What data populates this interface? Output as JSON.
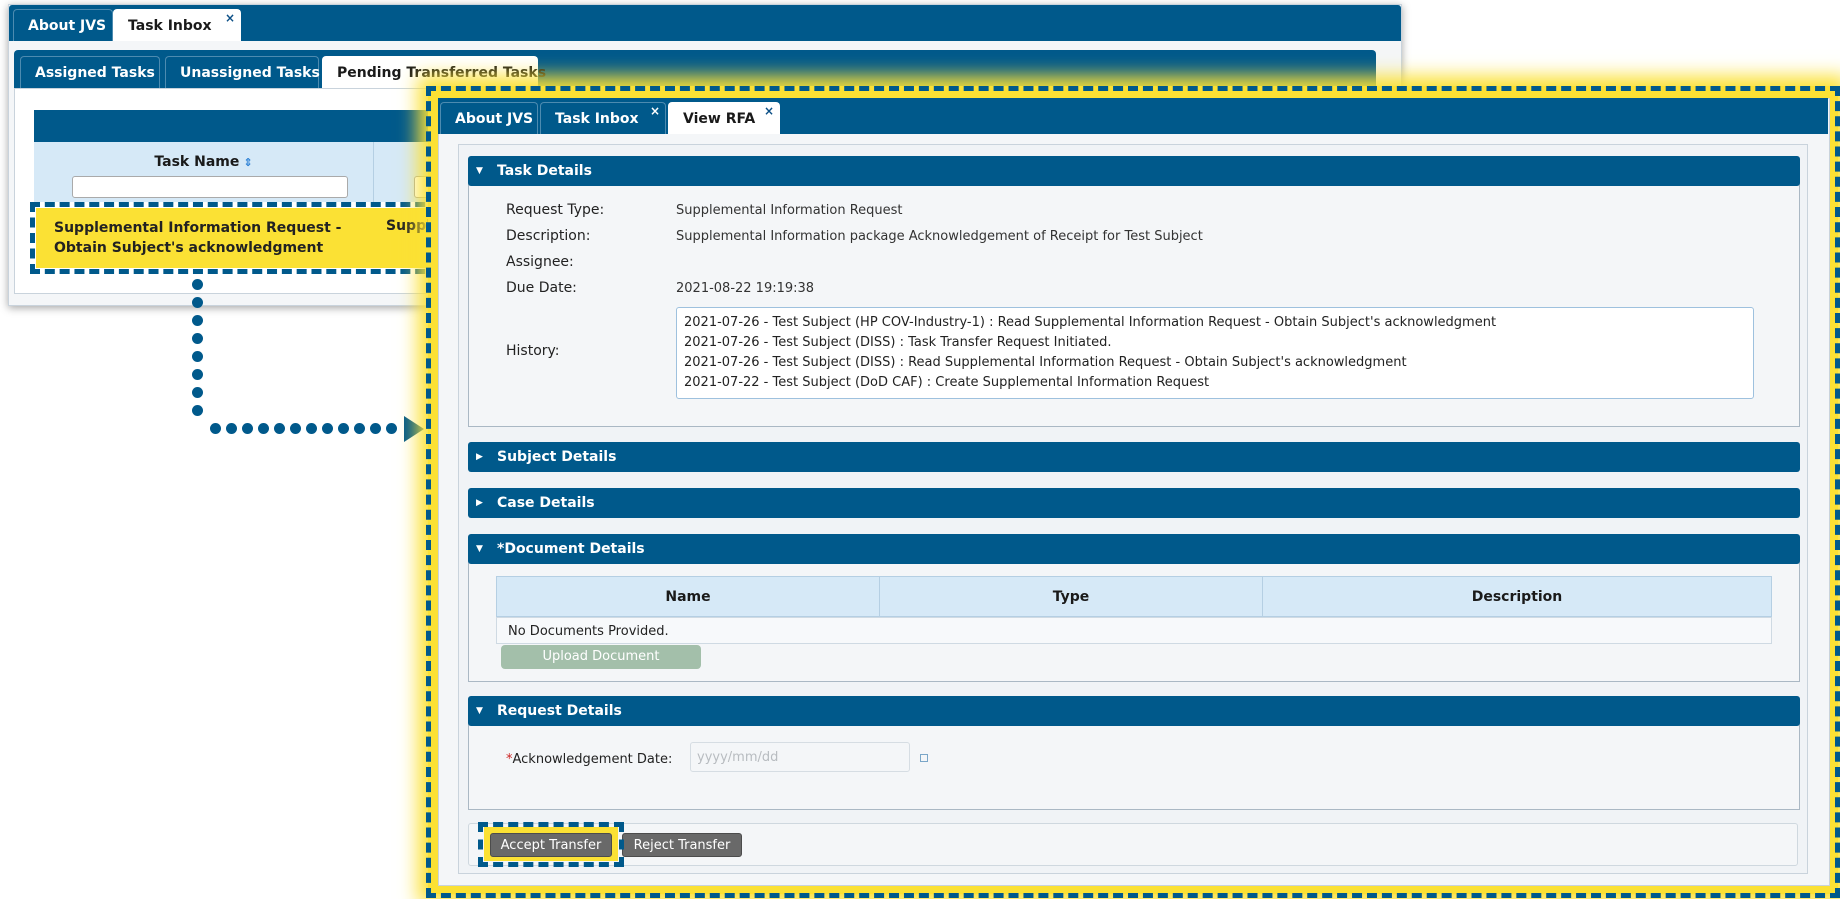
{
  "background_window": {
    "tabs": [
      {
        "label": "About JVS",
        "closable": false,
        "active": false
      },
      {
        "label": "Task Inbox",
        "closable": true,
        "active": true
      }
    ],
    "sub_tabs": [
      {
        "label": "Assigned Tasks",
        "active": false
      },
      {
        "label": "Unassigned Tasks",
        "active": false
      },
      {
        "label": "Pending Transferred Tasks",
        "active": true
      }
    ],
    "table": {
      "column_task_name": "Task Name",
      "highlighted_row": {
        "task_name": "Supplemental Information Request - Obtain Subject's acknowledgment",
        "col2_preview": "Supplem"
      }
    }
  },
  "foreground_window": {
    "tabs": [
      {
        "label": "About JVS",
        "closable": false,
        "active": false
      },
      {
        "label": "Task Inbox",
        "closable": true,
        "active": false
      },
      {
        "label": "View RFA",
        "closable": true,
        "active": true
      }
    ],
    "close_glyph": "×",
    "task_details": {
      "title": "Task Details",
      "request_type_label": "Request Type:",
      "request_type_value": "Supplemental Information Request",
      "description_label": "Description:",
      "description_value": "Supplemental Information package Acknowledgement of Receipt for Test Subject",
      "assignee_label": "Assignee:",
      "assignee_value": "",
      "due_date_label": "Due Date:",
      "due_date_value": "2021-08-22 19:19:38",
      "history_label": "History:",
      "history": [
        "2021-07-26 - Test Subject (HP COV-Industry-1) : Read Supplemental Information Request - Obtain Subject's acknowledgment",
        "2021-07-26 - Test Subject (DISS) : Task Transfer Request Initiated.",
        "2021-07-26 - Test Subject (DISS) : Read Supplemental Information Request - Obtain Subject's acknowledgment",
        "2021-07-22 - Test Subject (DoD CAF) : Create Supplemental Information Request"
      ]
    },
    "subject_details": {
      "title": "Subject Details"
    },
    "case_details": {
      "title": "Case Details"
    },
    "document_details": {
      "title": "*Document Details",
      "columns": [
        "Name",
        "Type",
        "Description"
      ],
      "empty_message": "No Documents Provided.",
      "upload_label": "Upload Document"
    },
    "request_details": {
      "title": "Request Details",
      "required_mark": "*",
      "ack_date_label": "Acknowledgement Date:",
      "ack_date_placeholder": "yyyy/mm/dd"
    },
    "actions": {
      "accept_label": "Accept Transfer",
      "reject_label": "Reject Transfer"
    }
  },
  "icons": {
    "expanded": "chevron-down-icon",
    "collapsed": "chevron-right-icon",
    "sort": "sort-icon",
    "calendar": "calendar-icon"
  },
  "colors": {
    "primary": "#00598b",
    "highlight": "#fbe134",
    "header_cell": "#d6e9f7",
    "button_gray": "#696969",
    "upload_disabled": "#a3bfaa",
    "required": "#cc2222"
  }
}
